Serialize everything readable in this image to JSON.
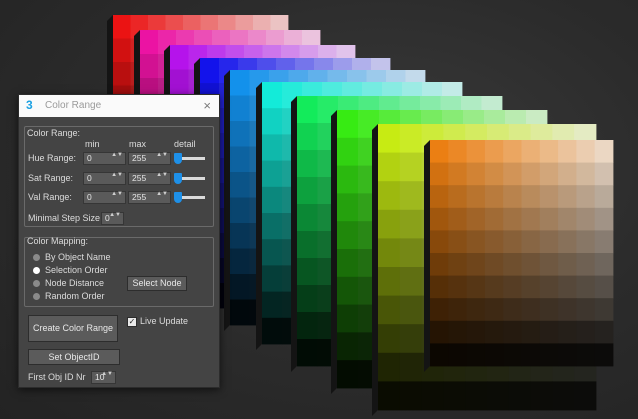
{
  "window": {
    "title": "Color Range",
    "app_icon": "3",
    "close_icon": "×"
  },
  "color_range": {
    "group_label": "Color Range:",
    "col_min": "min",
    "col_max": "max",
    "col_detail": "detail",
    "rows": [
      {
        "label": "Hue Range:",
        "min": "0",
        "max": "255",
        "detail_level": 0.05
      },
      {
        "label": "Sat Range:",
        "min": "0",
        "max": "255",
        "detail_level": 0.05
      },
      {
        "label": "Val Range:",
        "min": "0",
        "max": "255",
        "detail_level": 0.05
      }
    ],
    "min_step_label": "Minimal Step Size",
    "min_step_value": "0"
  },
  "color_mapping": {
    "group_label": "Color Mapping:",
    "options": [
      "By Object Name",
      "Selection Order",
      "Node Distance",
      "Random Order"
    ],
    "selected": "Selection Order",
    "select_node_label": "Select Node"
  },
  "actions": {
    "create_label": "Create Color Range",
    "live_update_label": "Live Update",
    "live_update_checked": true,
    "set_objectid_label": "Set ObjectID",
    "first_obj_label": "First Obj ID Nr",
    "first_obj_value": "10"
  },
  "spinner_arrows": "▲▼",
  "colors": {
    "accent": "#1e90e8",
    "background": "#2b2b2b",
    "panel": "#444444"
  }
}
